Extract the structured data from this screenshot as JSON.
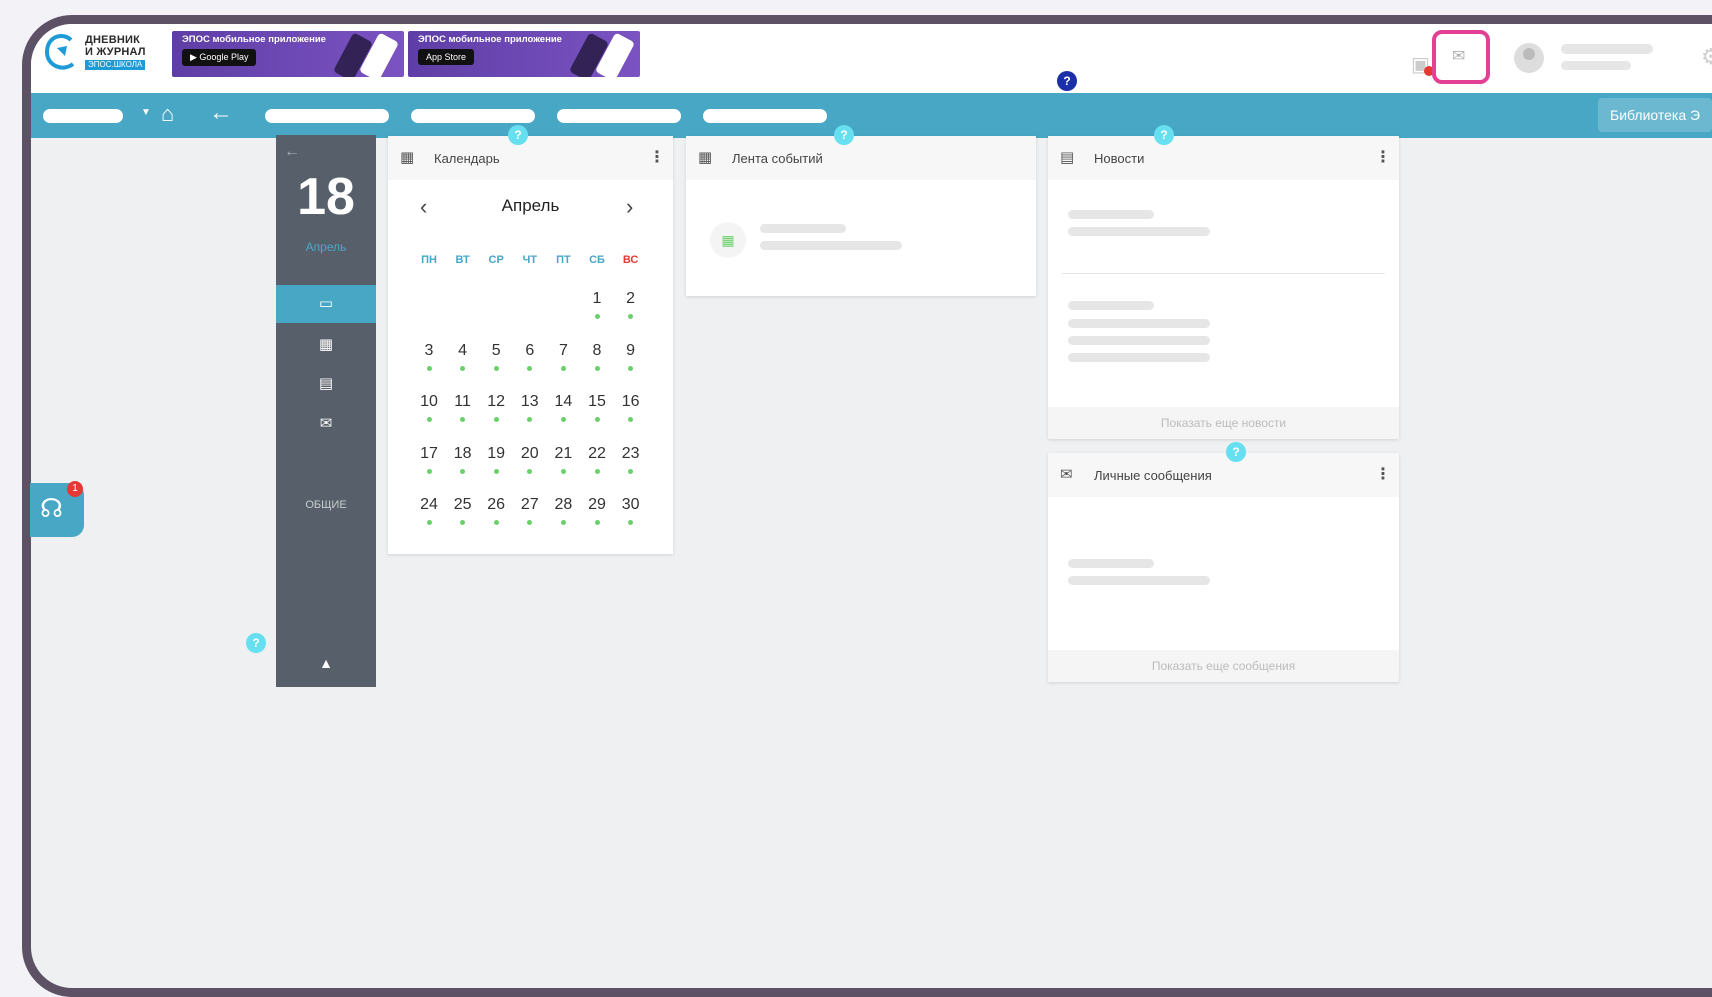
{
  "header": {
    "logo": {
      "line1": "ДНЕВНИК",
      "line2": "И ЖУРНАЛ",
      "sub": "ЭПОС.ШКОЛА"
    },
    "banners": [
      {
        "title": "ЭПОС мобильное приложение",
        "store": "Google Play"
      },
      {
        "title": "ЭПОС мобильное приложение",
        "store": "App Store"
      }
    ],
    "help_mark": "?",
    "icons": [
      "chat-icon",
      "mail-icon",
      "avatar-icon",
      "gear-icon"
    ]
  },
  "navbar": {
    "library_label": "Библиотека Э",
    "icons": [
      "home-icon",
      "back-arrow-icon"
    ]
  },
  "sidebar": {
    "day": "18",
    "month": "Апрель",
    "general_label": "ОБЩИЕ",
    "items": [
      "widgets-icon",
      "calendar-icon",
      "news-icon",
      "mail-icon"
    ]
  },
  "side_tab": {
    "badge": "1"
  },
  "calendar_card": {
    "title": "Календарь",
    "month": "Апрель",
    "weekdays": [
      "ПН",
      "ВТ",
      "СР",
      "ЧТ",
      "ПТ",
      "СБ",
      "ВС"
    ],
    "weeks": [
      [
        "",
        "",
        "",
        "",
        "",
        "1",
        "2"
      ],
      [
        "3",
        "4",
        "5",
        "6",
        "7",
        "8",
        "9"
      ],
      [
        "10",
        "11",
        "12",
        "13",
        "14",
        "15",
        "16"
      ],
      [
        "17",
        "18",
        "19",
        "20",
        "21",
        "22",
        "23"
      ],
      [
        "24",
        "25",
        "26",
        "27",
        "28",
        "29",
        "30"
      ]
    ]
  },
  "events_card": {
    "title": "Лента событий"
  },
  "news_card": {
    "title": "Новости",
    "show_more": "Показать еще новости"
  },
  "messages_card": {
    "title": "Личные сообщения",
    "show_more": "Показать еще сообщения"
  },
  "colors": {
    "accent": "#47a7c4",
    "sidebar": "#57606a",
    "highlight": "#e33f93",
    "weekend": "#e53935",
    "event_dot": "#6ad06a"
  }
}
